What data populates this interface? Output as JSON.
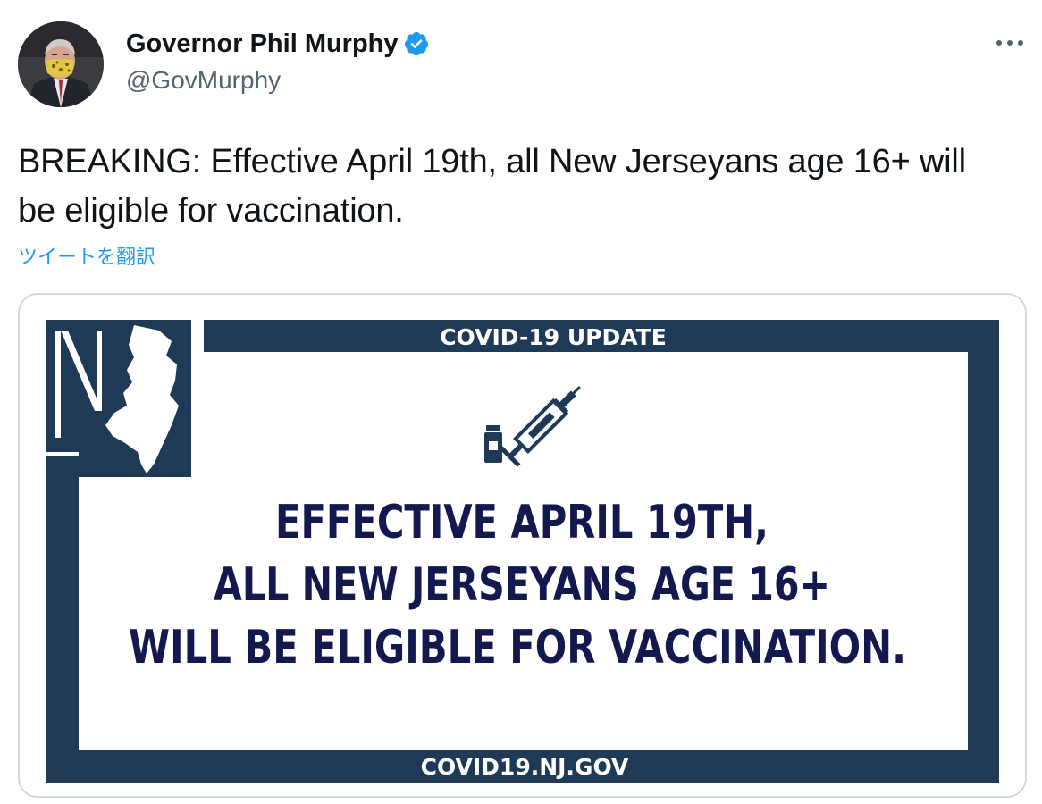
{
  "author": {
    "display_name": "Governor Phil Murphy",
    "handle": "@GovMurphy",
    "verified": true,
    "avatar_icon": "person-portrait-avatar"
  },
  "tweet": {
    "text": "BREAKING: Effective April 19th, all New Jerseyans age 16+ will be eligible for vaccination.",
    "translate_label": "ツイートを翻訳"
  },
  "menu": {
    "icon": "more-horizontal-icon"
  },
  "media": {
    "header_label": "COVID-19 UPDATE",
    "line1": "EFFECTIVE APRIL 19TH,",
    "line2": "ALL NEW JERSEYANS AGE 16+",
    "line3": "WILL BE ELIGIBLE FOR VACCINATION.",
    "footer_label": "COVID19.NJ.GOV",
    "logo_text": "NJ",
    "icon": "syringe-vial-icon"
  },
  "colors": {
    "link": "#1d9bf0",
    "verified": "#1d9bf0",
    "navy": "#1e3a56",
    "text_navy": "#13184f",
    "handle_gray": "#536471",
    "card_border": "#cfd9de"
  }
}
